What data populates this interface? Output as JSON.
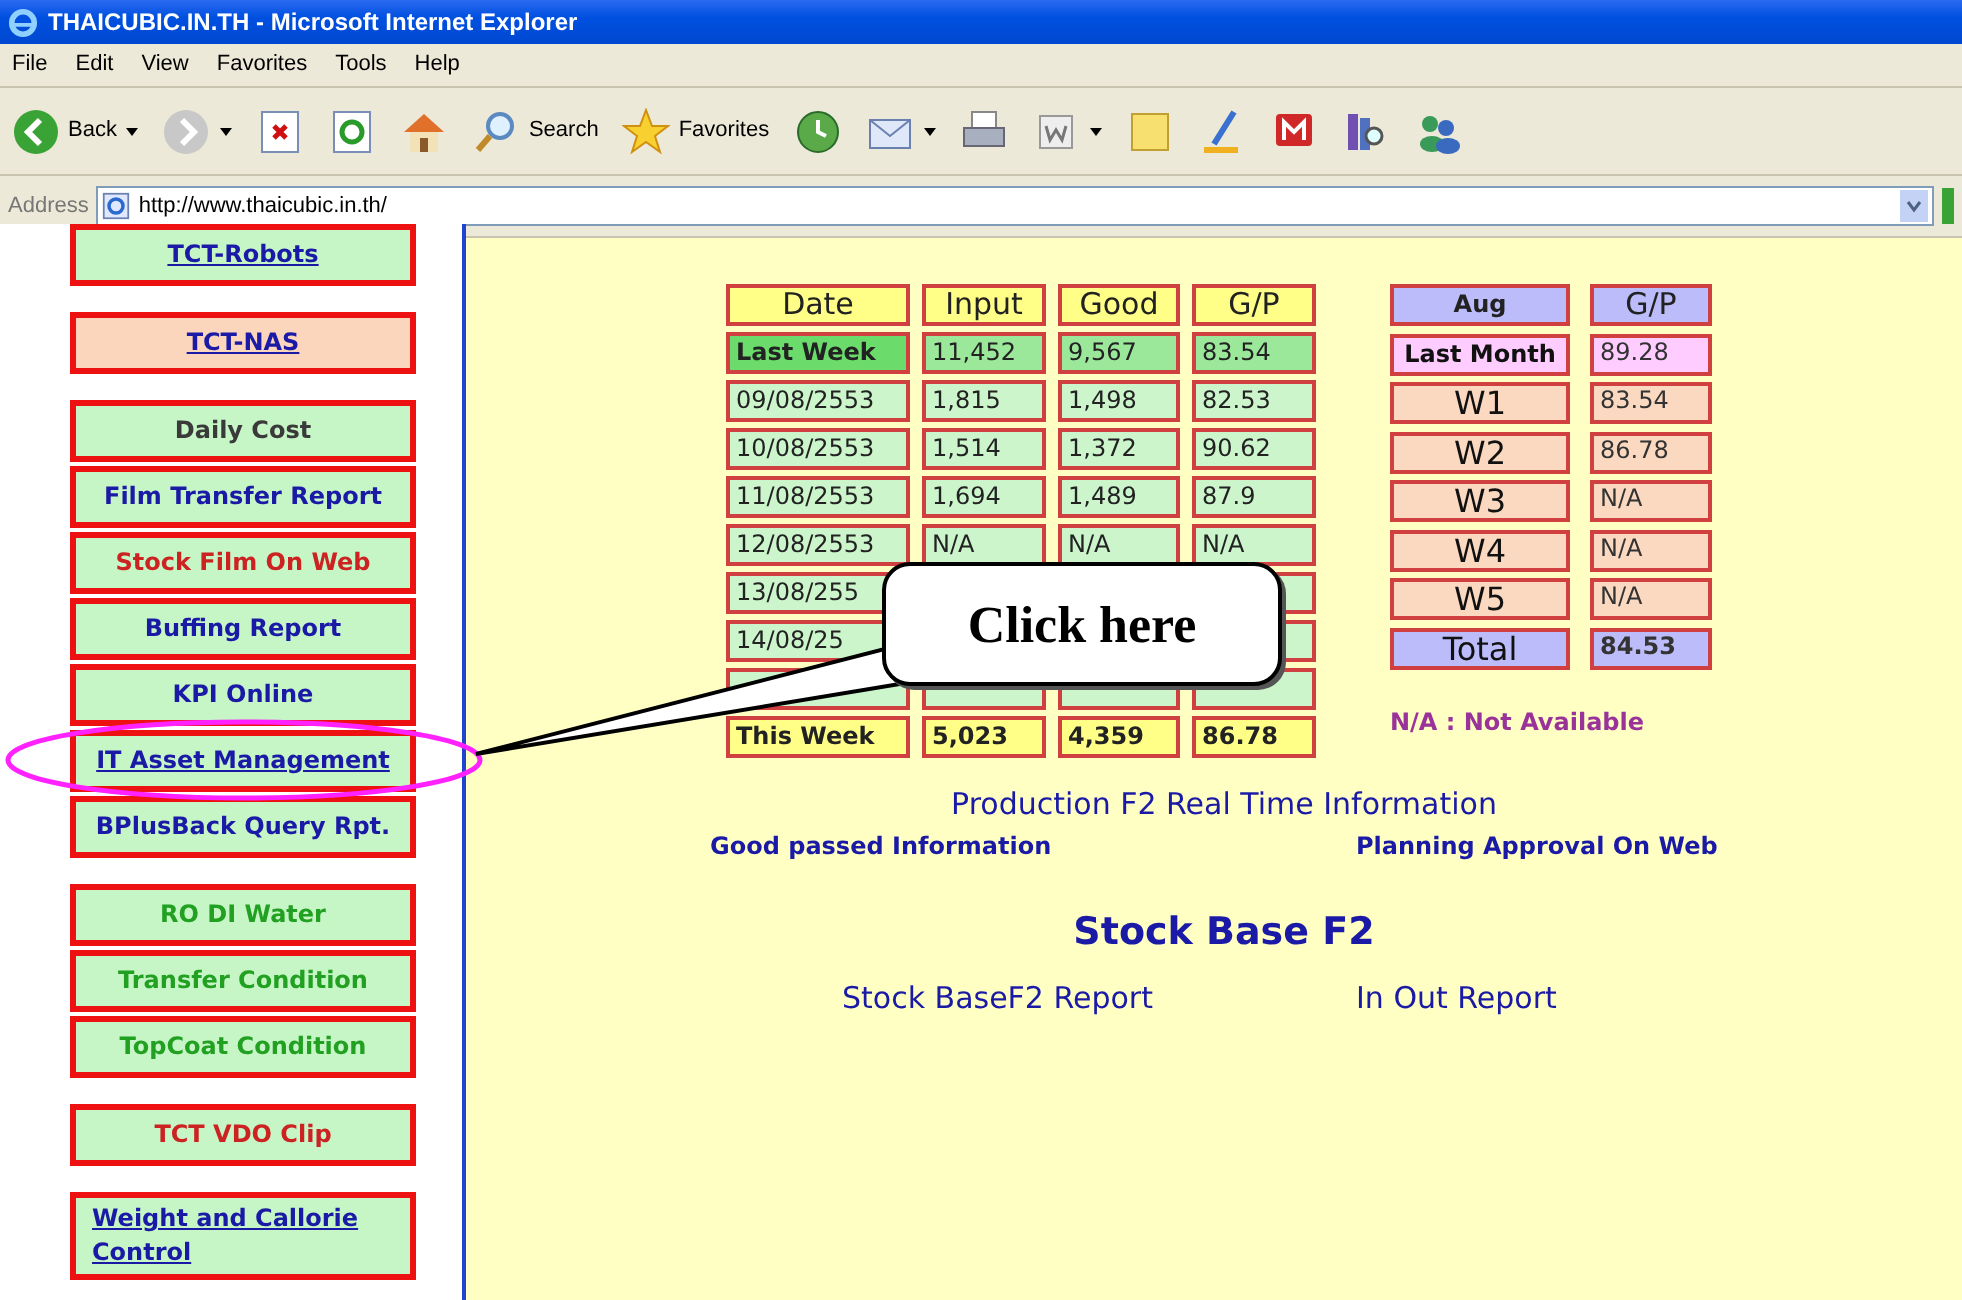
{
  "window": {
    "title": "THAICUBIC.IN.TH - Microsoft Internet Explorer"
  },
  "menu": [
    "File",
    "Edit",
    "View",
    "Favorites",
    "Tools",
    "Help"
  ],
  "toolbar": [
    {
      "kind": "back",
      "label": "Back",
      "dropdown": true
    },
    {
      "kind": "forward",
      "dropdown": true
    },
    {
      "kind": "stop",
      "dropdown": false
    },
    {
      "kind": "refresh",
      "dropdown": false
    },
    {
      "kind": "home",
      "dropdown": false
    },
    {
      "kind": "search",
      "label": "Search",
      "dropdown": false
    },
    {
      "kind": "favorites",
      "label": "Favorites",
      "dropdown": false
    },
    {
      "kind": "history",
      "dropdown": false
    },
    {
      "kind": "mail",
      "dropdown": true
    },
    {
      "kind": "print",
      "dropdown": false
    },
    {
      "kind": "word",
      "dropdown": true
    },
    {
      "kind": "note",
      "dropdown": false
    },
    {
      "kind": "pen",
      "dropdown": false
    },
    {
      "kind": "messenger",
      "dropdown": false
    },
    {
      "kind": "research",
      "dropdown": false
    },
    {
      "kind": "people",
      "dropdown": false
    }
  ],
  "address": {
    "label": "Address",
    "value": "http://www.thaicubic.in.th/"
  },
  "sidebar": {
    "groups": [
      {
        "items": [
          {
            "label": "TCT-Robots",
            "kind": "link",
            "color": "#1a1aa6",
            "highlighted": false
          }
        ]
      },
      {
        "items": [
          {
            "label": "TCT-NAS",
            "kind": "link",
            "color": "#1a1aa6",
            "highlighted": true
          }
        ]
      },
      {
        "items": [
          {
            "label": "Daily Cost",
            "kind": "text",
            "color": "#3a3a3a",
            "highlighted": false
          },
          {
            "label": "Film Transfer Report",
            "kind": "text",
            "color": "#1a1aa6",
            "highlighted": false
          },
          {
            "label": "Stock Film On Web",
            "kind": "text",
            "color": "#cc2222",
            "highlighted": false
          },
          {
            "label": "Buffing Report",
            "kind": "text",
            "color": "#1a1aa6",
            "highlighted": false
          },
          {
            "label": "KPI Online",
            "kind": "text",
            "color": "#1a1aa6",
            "highlighted": false
          },
          {
            "label": "IT Asset Management",
            "kind": "link",
            "color": "#1a1aa6",
            "highlighted": false
          },
          {
            "label": "BPlusBack Query Rpt.",
            "kind": "text",
            "color": "#1a1aa6",
            "highlighted": false
          }
        ]
      },
      {
        "items": [
          {
            "label": "RO DI Water",
            "kind": "text",
            "color": "#22a022",
            "highlighted": false
          },
          {
            "label": "Transfer Condition",
            "kind": "text",
            "color": "#22a022",
            "highlighted": false
          },
          {
            "label": "TopCoat Condition",
            "kind": "text",
            "color": "#22a022",
            "highlighted": false
          }
        ]
      },
      {
        "items": [
          {
            "label": "TCT VDO Clip",
            "kind": "text",
            "color": "#cc2222",
            "highlighted": false
          }
        ]
      },
      {
        "items": [
          {
            "label": "Weight and Callorie Control",
            "kind": "link",
            "color": "#1a1aa6",
            "highlighted": false
          }
        ]
      }
    ]
  },
  "daily_table": {
    "columns": [
      "Date",
      "Input",
      "Good",
      "G/P"
    ],
    "rows": [
      {
        "kind": "summary",
        "date": "Last Week",
        "input": "11,452",
        "good": "9,567",
        "gp": "83.54"
      },
      {
        "kind": "day",
        "date": "09/08/2553",
        "input": "1,815",
        "good": "1,498",
        "gp": "82.53"
      },
      {
        "kind": "day",
        "date": "10/08/2553",
        "input": "1,514",
        "good": "1,372",
        "gp": "90.62"
      },
      {
        "kind": "day",
        "date": "11/08/2553",
        "input": "1,694",
        "good": "1,489",
        "gp": "87.9"
      },
      {
        "kind": "day",
        "date": "12/08/2553",
        "input": "N/A",
        "good": "N/A",
        "gp": "N/A"
      },
      {
        "kind": "day",
        "date": "13/08/255"
      },
      {
        "kind": "day",
        "date": "14/08/25"
      },
      {
        "kind": "day"
      },
      {
        "kind": "total",
        "date": "This Week",
        "input": "5,023",
        "good": "4,359",
        "gp": "86.78"
      }
    ]
  },
  "monthly_table": {
    "columns": [
      "Aug",
      "G/P"
    ],
    "rows": [
      {
        "kind": "month",
        "label": "Last Month",
        "value": "89.28"
      },
      {
        "kind": "week",
        "label": "W1",
        "value": "83.54"
      },
      {
        "kind": "week",
        "label": "W2",
        "value": "86.78"
      },
      {
        "kind": "week",
        "label": "W3",
        "value": "N/A"
      },
      {
        "kind": "week",
        "label": "W4",
        "value": "N/A"
      },
      {
        "kind": "week",
        "label": "W5",
        "value": "N/A"
      },
      {
        "kind": "total",
        "label": "Total",
        "value": "84.53"
      }
    ],
    "note": "N/A : Not Available"
  },
  "production": {
    "title": "Production F2 Real Time Information",
    "links": [
      "Good passed Information",
      "Planning Approval On Web"
    ]
  },
  "stock": {
    "title": "Stock Base F2",
    "links": [
      "Stock BaseF2 Report",
      "In Out Report"
    ]
  },
  "callout": {
    "text": "Click here"
  }
}
